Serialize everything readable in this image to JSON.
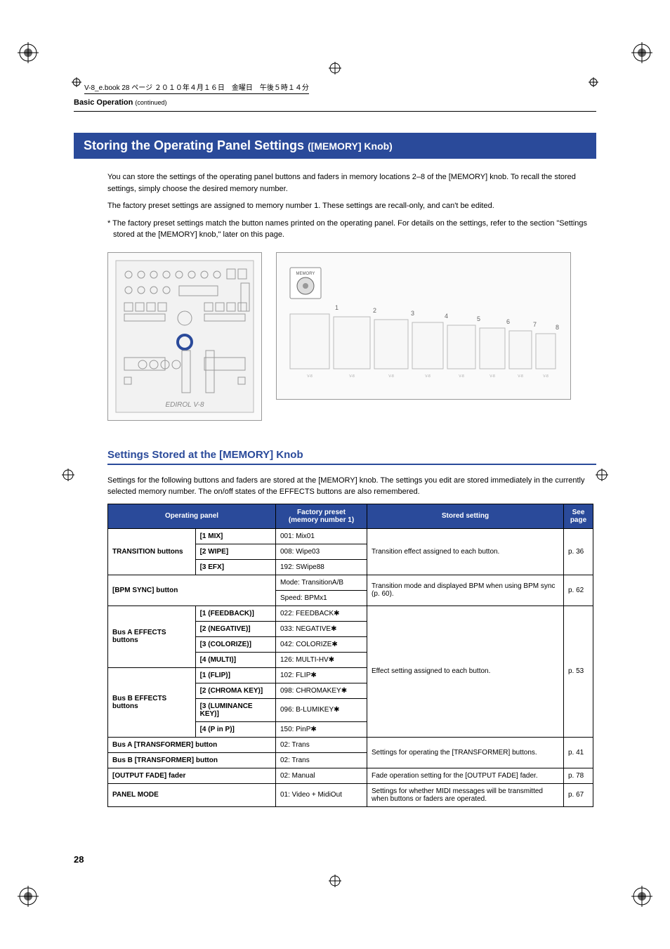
{
  "header_text": "V-8_e.book  28 ページ  ２０１０年４月１６日　金曜日　午後５時１４分",
  "section_label": "Basic Operation",
  "section_cont": "(continued)",
  "title_main": "Storing the Operating Panel Settings",
  "title_sub": "([MEMORY] Knob)",
  "para1": "You can store the settings of the operating panel buttons and faders in memory locations 2–8 of the [MEMORY] knob. To recall the stored settings, simply choose the desired memory number.",
  "para2": "The factory preset settings are assigned to memory number 1. These settings are recall-only, and can't be edited.",
  "note1": "* The factory preset settings match the button names printed on the operating panel. For details on the settings, refer to the section \"Settings stored at the [MEMORY] knob,\" later on this page.",
  "subheading": "Settings Stored at the [MEMORY] Knob",
  "para3": "Settings for the following buttons and faders are stored at the [MEMORY] knob. The settings you edit are stored immediately in the currently selected memory number. The on/off states of the EFFECTS buttons are also remembered.",
  "table": {
    "headers": {
      "op": "Operating panel",
      "factory": "Factory preset\n(memory number 1)",
      "stored": "Stored setting",
      "see": "See page"
    },
    "rows": [
      {
        "group": "TRANSITION buttons",
        "sub": "[1 MIX]",
        "factory": "001: Mix01",
        "stored": "Transition effect assigned to each button.",
        "page": "p. 36",
        "groupspan": 3
      },
      {
        "sub": "[2 WIPE]",
        "factory": "008: Wipe03"
      },
      {
        "sub": "[3 EFX]",
        "factory": "192: SWipe88"
      },
      {
        "group": "[BPM SYNC] button",
        "factory": "Mode: TransitionA/B",
        "stored": "Transition mode and displayed BPM when using BPM sync (p. 60).",
        "page": "p. 62",
        "colspan": 2,
        "factoryspan": 2,
        "factory2": "Speed: BPMx1"
      },
      {
        "group": "Bus A EFFECTS buttons",
        "sub": "[1 (FEEDBACK)]",
        "factory": "022: FEEDBACK✱",
        "stored": "Effect setting assigned to each button.",
        "page": "p. 53",
        "groupspan": 4
      },
      {
        "sub": "[2 (NEGATIVE)]",
        "factory": "033: NEGATIVE✱"
      },
      {
        "sub": "[3 (COLORIZE)]",
        "factory": "042: COLORIZE✱"
      },
      {
        "sub": "[4 (MULTI)]",
        "factory": "126: MULTI-HV✱"
      },
      {
        "group": "Bus B EFFECTS buttons",
        "sub": "[1 (FLIP)]",
        "factory": "102: FLIP✱",
        "groupspan": 4
      },
      {
        "sub": "[2 (CHROMA KEY)]",
        "factory": "098: CHROMAKEY✱"
      },
      {
        "sub": "[3 (LUMINANCE KEY)]",
        "factory": "096: B-LUMIKEY✱"
      },
      {
        "sub": "[4 (P in P)]",
        "factory": "150: PinP✱"
      },
      {
        "group": "Bus A [TRANSFORMER] button",
        "factory": "02: Trans",
        "stored": "Settings for operating the [TRANSFORMER] buttons.",
        "page": "p. 41",
        "colspan": 2
      },
      {
        "group": "Bus B [TRANSFORMER] button",
        "factory": "02: Trans",
        "colspan": 2
      },
      {
        "group": "[OUTPUT FADE] fader",
        "factory": "02: Manual",
        "stored": "Fade operation setting for the [OUTPUT FADE] fader.",
        "page": "p. 78",
        "colspan": 2
      },
      {
        "group": "PANEL MODE",
        "factory": "01: Video + MidiOut",
        "stored": "Settings for whether MIDI messages will be transmitted when buttons or faders are operated.",
        "page": "p. 67",
        "colspan": 2
      }
    ]
  },
  "page_number": "28",
  "seq_labels": [
    "1",
    "2",
    "3",
    "4",
    "5",
    "6",
    "7",
    "8"
  ]
}
